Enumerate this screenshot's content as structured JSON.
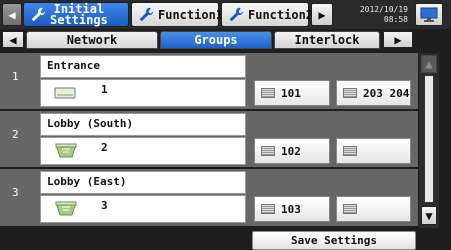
{
  "header": {
    "tabs": [
      {
        "label_line1": "Initial",
        "label_line2": "Settings",
        "icon": "wrench-icon",
        "active": true
      },
      {
        "label": "Function1",
        "icon": "wrench-icon",
        "active": false
      },
      {
        "label": "Function2",
        "icon": "wrench-icon",
        "active": false
      }
    ],
    "date": "2012/10/19",
    "time": "08:58"
  },
  "subtabs": [
    {
      "label": "Network",
      "active": false
    },
    {
      "label": "Groups",
      "active": true
    },
    {
      "label": "Interlock",
      "active": false
    }
  ],
  "groups": [
    {
      "number": "1",
      "name": "Entrance",
      "unit_count": "1",
      "unit_icon": "indoor-unit-icon",
      "cell_a": "101",
      "cell_b": "203 204"
    },
    {
      "number": "2",
      "name": "Lobby (South)",
      "unit_count": "2",
      "unit_icon": "ceiling-cassette-icon",
      "cell_a": "102",
      "cell_b": ""
    },
    {
      "number": "3",
      "name": "Lobby (East)",
      "unit_count": "3",
      "unit_icon": "ceiling-cassette-icon",
      "cell_a": "103",
      "cell_b": ""
    }
  ],
  "footer": {
    "save_label": "Save Settings"
  }
}
